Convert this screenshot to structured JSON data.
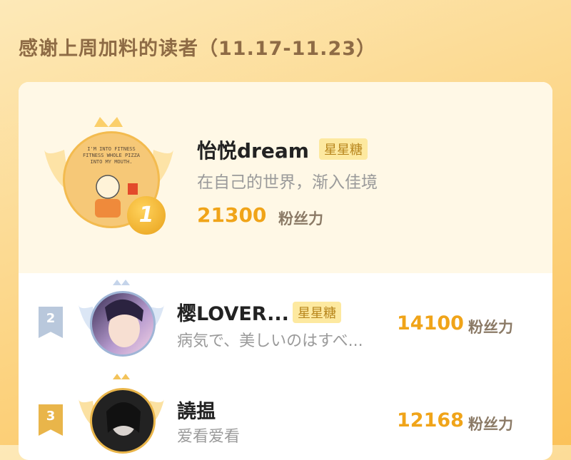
{
  "header": {
    "title": "感谢上周加料的读者（11.17-11.23）"
  },
  "colors": {
    "accent": "#f0a419",
    "badge_bg": "#fde9a0",
    "badge_text": "#b8861d"
  },
  "readers": [
    {
      "rank": "1",
      "name": "怡悦dream",
      "badge": "星星糖",
      "signature": "在自己的世界，渐入佳境",
      "score": "21300",
      "unit": "粉丝力",
      "avatar_text": [
        "I'M INTO FITNESS",
        "FITNESS WHOLE PIZZA",
        "INTO MY MOUTH."
      ]
    },
    {
      "rank": "2",
      "name": "樱LOVER...",
      "badge": "星星糖",
      "signature": "病気で、美しいのはすべ...",
      "score": "14100",
      "unit": "粉丝力"
    },
    {
      "rank": "3",
      "name": "譊揾",
      "signature": "爱看爱看",
      "score": "12168",
      "unit": "粉丝力"
    }
  ]
}
